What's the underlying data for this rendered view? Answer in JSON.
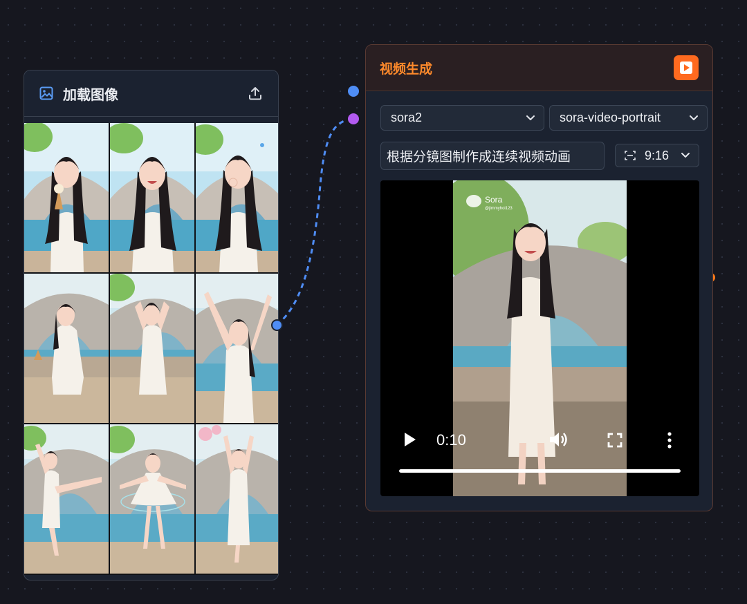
{
  "load_image_node": {
    "title": "加载图像",
    "icons": {
      "header": "image-icon",
      "action": "upload-icon"
    },
    "images": [
      "ice-cream",
      "laughing",
      "covering-mouth",
      "sitting-with-cone",
      "hands-in-hair",
      "arms-raised",
      "arabesque",
      "spinning",
      "ballet-pose"
    ]
  },
  "video_node": {
    "title": "视频生成",
    "run_icon": "play-icon",
    "model": "sora2",
    "variant": "sora-video-portrait",
    "prompt": "根据分镜图制作成连续视频动画",
    "aspect_ratio": "9:16",
    "player": {
      "time": "0:10",
      "watermark": "Sora",
      "watermark_sub": "@jimmyhoi123",
      "progress": 1.0
    }
  },
  "colors": {
    "accent_orange": "#ff6a1f",
    "title_orange": "#ff8a2b",
    "port_blue": "#4f8df5",
    "port_purple": "#b35af0",
    "port_orange": "#ff7a1a",
    "edge_blue": "#4f8df5"
  }
}
